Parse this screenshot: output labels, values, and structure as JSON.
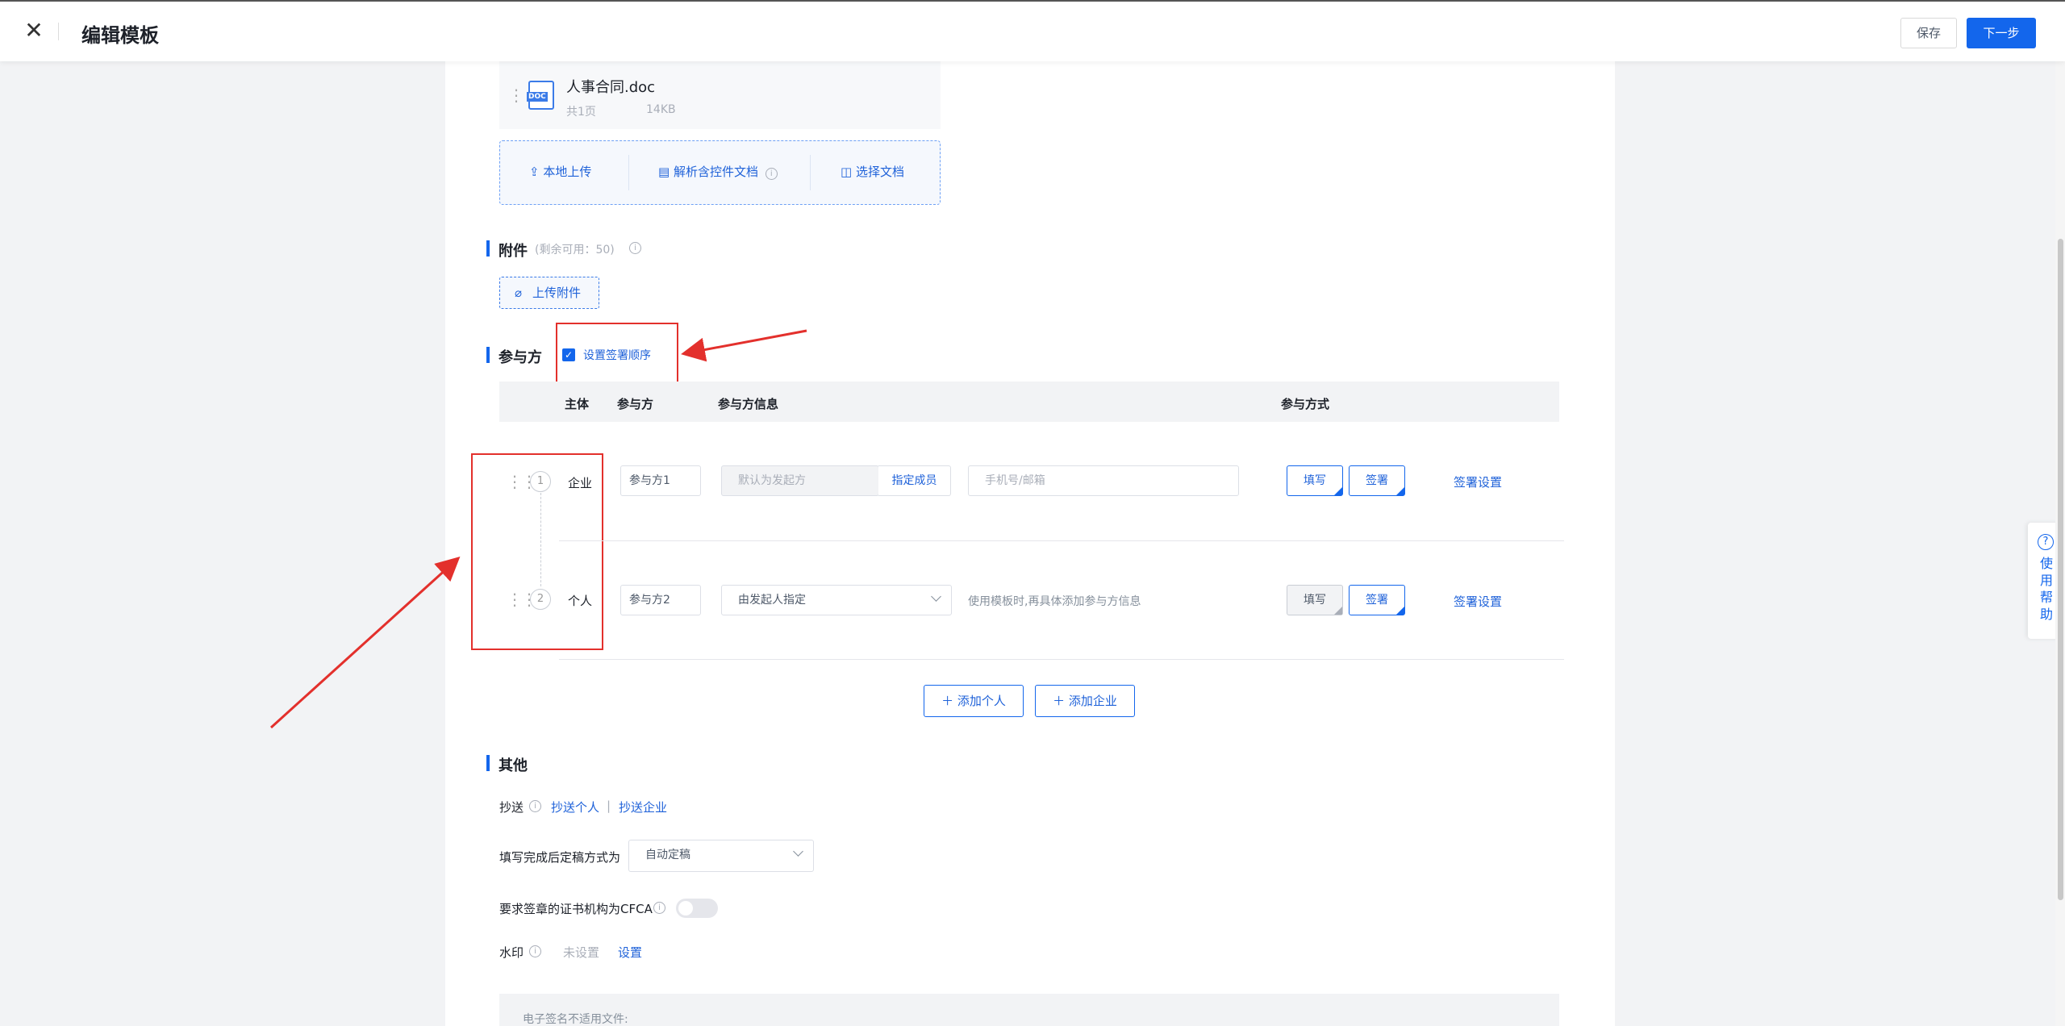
{
  "header": {
    "close_icon": "close-icon",
    "title": "编辑模板",
    "save_label": "保存",
    "next_label": "下一步"
  },
  "document": {
    "file_name": "人事合同.doc",
    "file_type": "DOC",
    "pages": "共1页",
    "size": "14KB",
    "actions": {
      "local_upload": "本地上传",
      "parse_control_doc": "解析含控件文档",
      "choose_doc": "选择文档"
    }
  },
  "attachments": {
    "title": "附件",
    "remaining": "(剩余可用：50)",
    "upload_label": "上传附件"
  },
  "participants": {
    "title": "参与方",
    "sign_order_label": "设置签署顺序",
    "sign_order_checked": true,
    "columns": {
      "subject": "主体",
      "party": "参与方",
      "party_info": "参与方信息",
      "method": "参与方式"
    },
    "rows": [
      {
        "order": "1",
        "subject": "企业",
        "party_name": "参与方1",
        "info_value": "默认为发起方",
        "assign_member": "指定成员",
        "contact_placeholder": "手机号/邮箱",
        "fill_label": "填写",
        "fill_active": true,
        "sign_label": "签署",
        "sign_active": true,
        "settings_label": "签署设置"
      },
      {
        "order": "2",
        "subject": "个人",
        "party_name": "参与方2",
        "info_value": "由发起人指定",
        "contact_hint": "使用模板时,再具体添加参与方信息",
        "fill_label": "填写",
        "fill_active": false,
        "sign_label": "签署",
        "sign_active": true,
        "settings_label": "签署设置"
      }
    ],
    "add_person": "添加个人",
    "add_company": "添加企业"
  },
  "other": {
    "title": "其他",
    "cc_label": "抄送",
    "cc_person": "抄送个人",
    "cc_separator": "|",
    "cc_company": "抄送企业",
    "finalize_label": "填写完成后定稿方式为",
    "finalize_value": "自动定稿",
    "cfca_label": "要求签章的证书机构为CFCA",
    "cfca_enabled": false,
    "watermark_label": "水印",
    "watermark_status": "未设置",
    "watermark_action": "设置",
    "esign_note": "电子签名不适用文件:"
  },
  "help": {
    "label": "使用帮助"
  },
  "colors": {
    "primary": "#1366ec",
    "annotation": "#e3302c"
  }
}
